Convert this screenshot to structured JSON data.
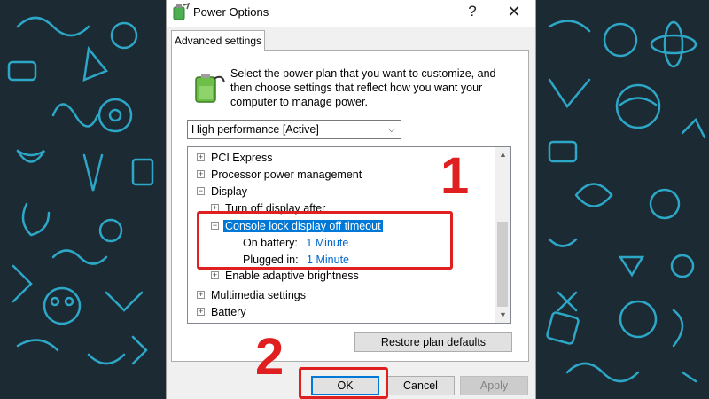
{
  "window": {
    "title": "Power Options",
    "help_glyph": "?",
    "close_glyph": "✕"
  },
  "tab": {
    "label": "Advanced settings"
  },
  "description": "Select the power plan that you want to customize, and then choose settings that reflect how you want your computer to manage power.",
  "plan_select": {
    "selected": "High performance [Active]",
    "arrow": "⌵"
  },
  "tree": {
    "items": [
      {
        "label": "PCI Express",
        "expander": "+"
      },
      {
        "label": "Processor power management",
        "expander": "+"
      },
      {
        "label": "Display",
        "expander": "−"
      },
      {
        "label": "Turn off display after",
        "expander": "+"
      },
      {
        "label": "Console lock display off timeout",
        "expander": "−"
      },
      {
        "label": "On battery:",
        "value": "1 Minute"
      },
      {
        "label": "Plugged in:",
        "value": "1 Minute"
      },
      {
        "label": "Enable adaptive brightness",
        "expander": "+"
      },
      {
        "label": "Multimedia settings",
        "expander": "+"
      },
      {
        "label": "Battery",
        "expander": "+"
      }
    ]
  },
  "buttons": {
    "restore": "Restore plan defaults",
    "ok": "OK",
    "cancel": "Cancel",
    "apply": "Apply"
  },
  "annotations": {
    "step1": "1",
    "step2": "2",
    "highlight_color": "#e02020"
  },
  "icons": [
    "power-options-icon",
    "battery-plan-icon",
    "help-icon",
    "close-icon",
    "chevron-down-icon"
  ],
  "colors": {
    "selection": "#0078d7",
    "link": "#0066cc",
    "background": "#1b2a33",
    "doodle": "#2fb5d8"
  }
}
